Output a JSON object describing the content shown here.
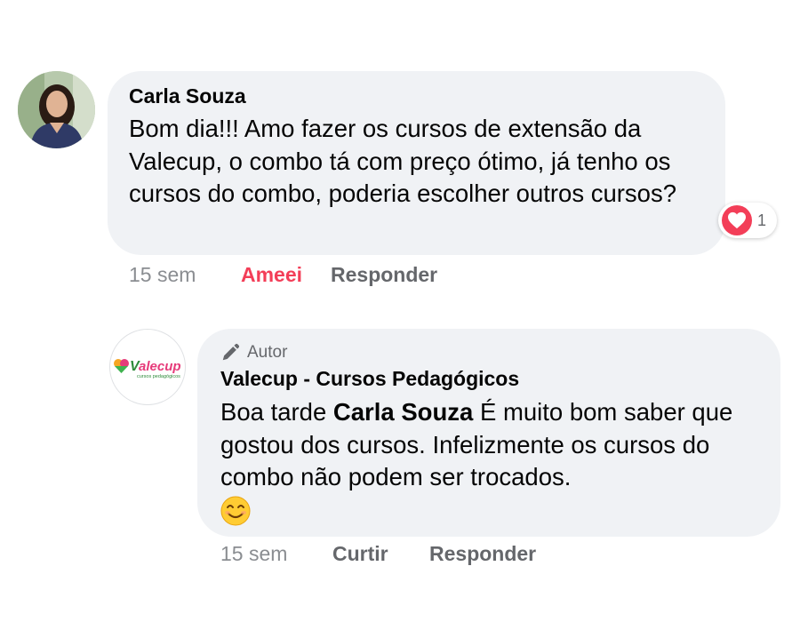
{
  "comment": {
    "author": "Carla Souza",
    "text": "Bom dia!!! Amo fazer os cursos de extensão da Valecup,  o combo tá com preço ótimo,  já tenho os cursos do combo, poderia escolher outros cursos?",
    "reaction": {
      "icon": "heart-icon",
      "color": "#f33e58",
      "count": "1"
    },
    "actions": {
      "time": "15 sem",
      "like": "Ameei",
      "reply": "Responder"
    }
  },
  "reply": {
    "badge": "Autor",
    "badge_icon": "pencil-icon",
    "author": "Valecup - Cursos Pedagógicos",
    "greeting": "Boa tarde",
    "mention": "Carla Souza",
    "text": "É muito bom saber que gostou dos cursos. Infelizmente os cursos do combo não podem ser trocados.",
    "emoji": "smiling-face-icon",
    "logo": {
      "name": "Valecup",
      "tagline": "cursos pedagógicos"
    },
    "actions": {
      "time": "15 sem",
      "like": "Curtir",
      "reply": "Responder"
    }
  }
}
